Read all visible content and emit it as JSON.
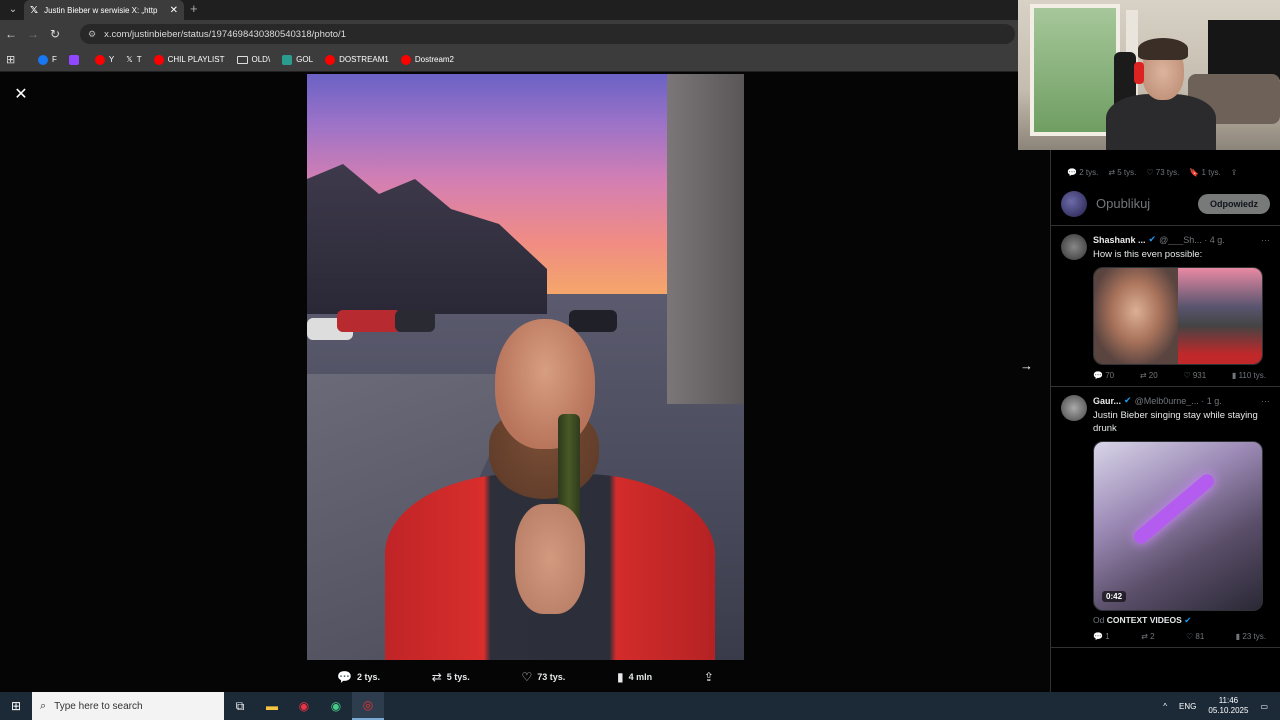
{
  "browser": {
    "tab_title": "Justin Bieber w serwisie X: „http",
    "url": "x.com/justinbieber/status/1974698430380540318/photo/1",
    "bookmarks": [
      {
        "label": "F",
        "color": "#1877f2"
      },
      {
        "label": "",
        "color": "#9146ff"
      },
      {
        "label": "Y",
        "color": "#ff0000"
      },
      {
        "label": "T",
        "color": "#ffffff"
      },
      {
        "label": "CHIL PLAYLIST",
        "color": "#ff0000"
      },
      {
        "label": "OLD\\",
        "color": "folder"
      },
      {
        "label": "GOL",
        "color": "#2a9d8f"
      },
      {
        "label": "DOSTREAM1",
        "color": "#ff0000"
      },
      {
        "label": "Dostream2",
        "color": "#ff0000"
      }
    ]
  },
  "viewer": {
    "actions": {
      "replies": "2 tys.",
      "reposts": "5 tys.",
      "likes": "73 tys.",
      "views": "4 mln"
    }
  },
  "sidebar": {
    "stats": {
      "replies": "2 tys.",
      "reposts": "5 tys.",
      "likes": "73 tys.",
      "bookmarks": "1 tys."
    },
    "reply_placeholder": "Opublikuj",
    "reply_button": "Odpowiedz",
    "posts": [
      {
        "name": "Shashank ...",
        "handle": "@___Sh...",
        "time": "4 g.",
        "text": "How is this even possible:",
        "metrics": {
          "replies": "70",
          "reposts": "20",
          "likes": "931",
          "views": "110 tys."
        }
      },
      {
        "name": "Gaur...",
        "handle": "@Melb0urne_...",
        "time": "1 g.",
        "text": "Justin Bieber singing stay while staying drunk",
        "duration": "0:42",
        "from_prefix": "Od",
        "from_name": "CONTEXT VIDEOS",
        "metrics": {
          "replies": "1",
          "reposts": "2",
          "likes": "81",
          "views": "23 tys."
        }
      }
    ]
  },
  "taskbar": {
    "search_placeholder": "Type here to search",
    "lang": "ENG",
    "time": "11:46",
    "date": "05.10.2025"
  }
}
